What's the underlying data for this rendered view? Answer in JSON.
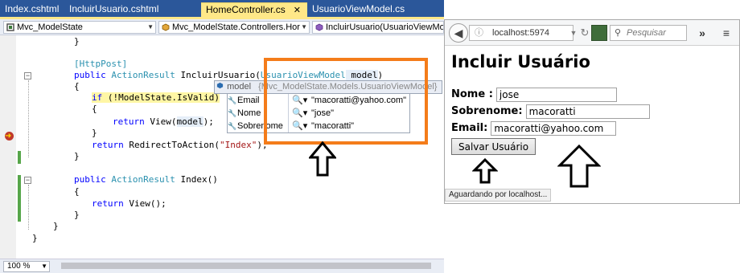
{
  "ide": {
    "tabs": [
      {
        "label": "Index.cshtml"
      },
      {
        "label": "IncluirUsuario.cshtml"
      },
      {
        "label": "HomeController.cs",
        "close": "✕"
      },
      {
        "label": "UsuarioViewModel.cs"
      }
    ],
    "nav": {
      "project": "Mvc_ModelState",
      "class": "Mvc_ModelState.Controllers.Hor",
      "member": "IncluirUsuario(UsuarioViewMo"
    },
    "code_lines": {
      "l0": "}",
      "l1": "[HttpPost]",
      "l2_kw1": "public",
      "l2_ty1": "ActionResult",
      "l2_name": " IncluirUsuario(",
      "l2_ty2": "UsuarioViewModel",
      "l2_param": " model",
      "l2_end": ")",
      "l3": "{",
      "l4_kw": "if",
      "l4_rest": " (!ModelState.IsValid)",
      "l5": "{",
      "l6_kw": "return",
      "l6_rest1": " View(",
      "l6_param": "model",
      "l6_rest2": ");",
      "l7": "}",
      "l8_kw": "return",
      "l8_rest1": " RedirectToAction(",
      "l8_str": "\"Index\"",
      "l8_rest2": ");",
      "l9": "}",
      "l10_kw1": "public",
      "l10_ty1": "ActionResult",
      "l10_rest": " Index()",
      "l11": "{",
      "l12_kw": "return",
      "l12_rest": " View();",
      "l13": "}",
      "l14": "}",
      "l15": "}"
    },
    "datatip": {
      "header_name": "model",
      "header_value": "{Mvc_ModelState.Models.UsuarioViewModel}",
      "rows": [
        {
          "name": "Email",
          "value": "\"macoratti@yahoo.com\""
        },
        {
          "name": "Nome",
          "value": "\"jose\""
        },
        {
          "name": "Sobrenome",
          "value": "\"macoratti\""
        }
      ]
    },
    "zoom": "100 %"
  },
  "browser": {
    "url": "localhost:5974",
    "search_placeholder": "Pesquisar",
    "page_title": "Incluir Usuário",
    "fields": [
      {
        "label": "Nome :",
        "value": "jose"
      },
      {
        "label": "Sobrenome:",
        "value": "macoratti"
      },
      {
        "label": "Email:",
        "value": "macoratti@yahoo.com"
      }
    ],
    "submit_label": "Salvar Usuário",
    "status": "Aguardando por localhost..."
  },
  "colors": {
    "tab_bar": "#2b579a",
    "active_tab": "#ffe888",
    "highlight_box": "#f47c1a",
    "breakpoint": "#c0392b",
    "change_bar": "#57a64a"
  },
  "icons": [
    "back-arrow-icon",
    "lock-icon",
    "reload-icon",
    "search-icon",
    "library-icon",
    "overflow-icon",
    "menu-icon",
    "wrench-icon",
    "magnifier-icon",
    "breakpoint-icon",
    "up-arrow-icon"
  ]
}
